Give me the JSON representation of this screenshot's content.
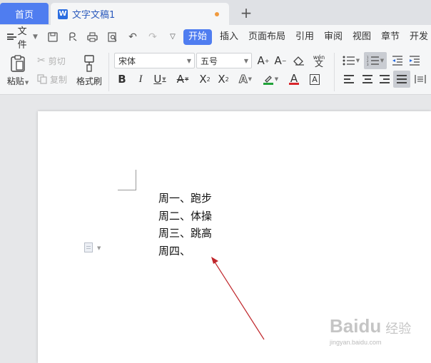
{
  "tabs": {
    "home": "首页",
    "doc_title": "文字文稿1",
    "doc_badge": "W",
    "new_tab": "+"
  },
  "menu": {
    "file": "文件",
    "tabs": [
      "开始",
      "插入",
      "页面布局",
      "引用",
      "审阅",
      "视图",
      "章节",
      "开发"
    ]
  },
  "ribbon": {
    "paste": "粘贴",
    "cut": "剪切",
    "copy": "复制",
    "format_painter": "格式刷",
    "font_name": "宋体",
    "font_size": "五号",
    "bold": "B",
    "italic": "I",
    "underline": "U",
    "font_color_letter": "A",
    "pinyin": "wén",
    "char_border": "A"
  },
  "document": {
    "lines": [
      "周一、跑步",
      "周二、体操",
      "周三、跳高",
      "周四、"
    ]
  },
  "watermark": {
    "logo": "Baidu",
    "cn": "经验",
    "url": "jingyan.baidu.com"
  },
  "colors": {
    "accent": "#4f7df0",
    "arrow": "#c0262b",
    "highlight": "#21a33a",
    "font_red": "#d9262b"
  }
}
